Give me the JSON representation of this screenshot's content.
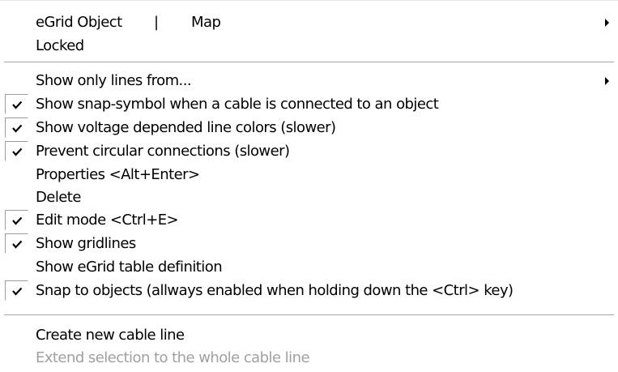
{
  "menu": {
    "egrid_object": {
      "label": "eGrid Object",
      "divider": "|",
      "map_label": "Map",
      "has_submenu": true
    },
    "locked": {
      "label": "Locked"
    },
    "show_only_lines": {
      "label": "Show only lines from...",
      "has_submenu": true
    },
    "show_snap_symbol": {
      "label": "Show snap-symbol when a cable is connected to an object",
      "checked": true
    },
    "show_voltage_colors": {
      "label": "Show voltage depended line colors (slower)",
      "checked": true
    },
    "prevent_circular": {
      "label": "Prevent circular connections (slower)",
      "checked": true
    },
    "properties": {
      "label": "Properties <Alt+Enter>"
    },
    "delete": {
      "label": "Delete"
    },
    "edit_mode": {
      "label": "Edit mode <Ctrl+E>",
      "checked": true
    },
    "show_gridlines": {
      "label": "Show gridlines",
      "checked": true
    },
    "show_table_definition": {
      "label": "Show eGrid table definition"
    },
    "snap_to_objects": {
      "label": "Snap to objects (allways enabled when holding down the <Ctrl> key)",
      "checked": true
    },
    "create_cable_line": {
      "label": "Create new cable line"
    },
    "extend_selection": {
      "label": "Extend selection to the whole cable line",
      "disabled": true
    }
  },
  "colors": {
    "text": "#000000",
    "disabled_text": "#a0a0a0",
    "separator": "#a6a6a6",
    "background": "#ffffff"
  }
}
